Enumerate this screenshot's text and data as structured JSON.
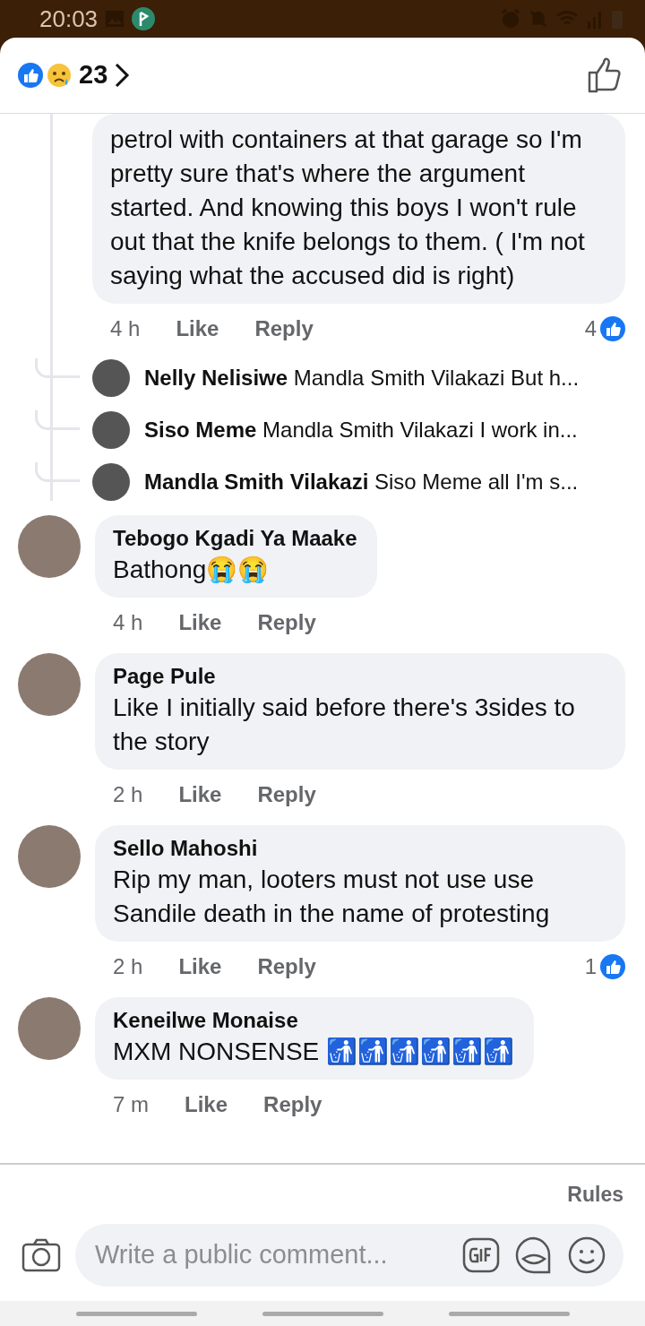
{
  "status_bar": {
    "time": "20:03"
  },
  "header": {
    "reaction_count": "23"
  },
  "comments": [
    {
      "kind": "partial",
      "text": "petrol with containers at that garage so I'm pretty sure that's where the argument started. And knowing this boys I won't rule out that the knife belongs to them. ( I'm not saying what the accused did is right)",
      "time": "4 h",
      "like": "Like",
      "reply": "Reply",
      "like_count": "4",
      "replies": [
        {
          "name": "Nelly Nelisiwe",
          "text": "Mandla Smith Vilakazi But h..."
        },
        {
          "name": "Siso Meme",
          "text": "Mandla Smith Vilakazi I  work in..."
        },
        {
          "name": "Mandla Smith Vilakazi",
          "text": "Siso Meme all I'm s..."
        }
      ]
    },
    {
      "kind": "full",
      "name": "Tebogo Kgadi Ya Maake",
      "text": "Bathong😭😭",
      "time": "4 h",
      "like": "Like",
      "reply": "Reply"
    },
    {
      "kind": "full",
      "name": "Page Pule",
      "text": "Like  I initially  said before there's 3sides to the story",
      "time": "2 h",
      "like": "Like",
      "reply": "Reply"
    },
    {
      "kind": "full",
      "name": "Sello Mahoshi",
      "text": "Rip my man, looters must not use use Sandile death in the name of protesting",
      "time": "2 h",
      "like": "Like",
      "reply": "Reply",
      "like_count": "1"
    },
    {
      "kind": "full",
      "name": "Keneilwe Monaise",
      "text": "MXM NONSENSE 🚮🚮🚮🚮🚮🚮",
      "time": "7 m",
      "like": "Like",
      "reply": "Reply"
    }
  ],
  "rules_link": "Rules",
  "composer": {
    "placeholder": "Write a public comment..."
  }
}
